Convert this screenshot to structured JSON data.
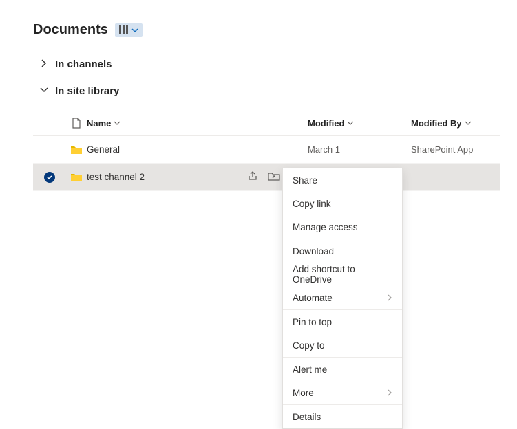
{
  "header": {
    "title": "Documents"
  },
  "sections": {
    "channels_label": "In channels",
    "library_label": "In site library"
  },
  "columns": {
    "name": "Name",
    "modified": "Modified",
    "modified_by": "Modified By"
  },
  "rows": [
    {
      "name": "General",
      "modified": "March 1",
      "modified_by": "SharePoint App",
      "selected": false
    },
    {
      "name": "test channel 2",
      "modified": "",
      "modified_by": "",
      "selected": true
    }
  ],
  "context_menu": {
    "share": "Share",
    "copy_link": "Copy link",
    "manage_access": "Manage access",
    "download": "Download",
    "add_shortcut": "Add shortcut to OneDrive",
    "automate": "Automate",
    "pin_to_top": "Pin to top",
    "copy_to": "Copy to",
    "alert_me": "Alert me",
    "more": "More",
    "details": "Details"
  }
}
